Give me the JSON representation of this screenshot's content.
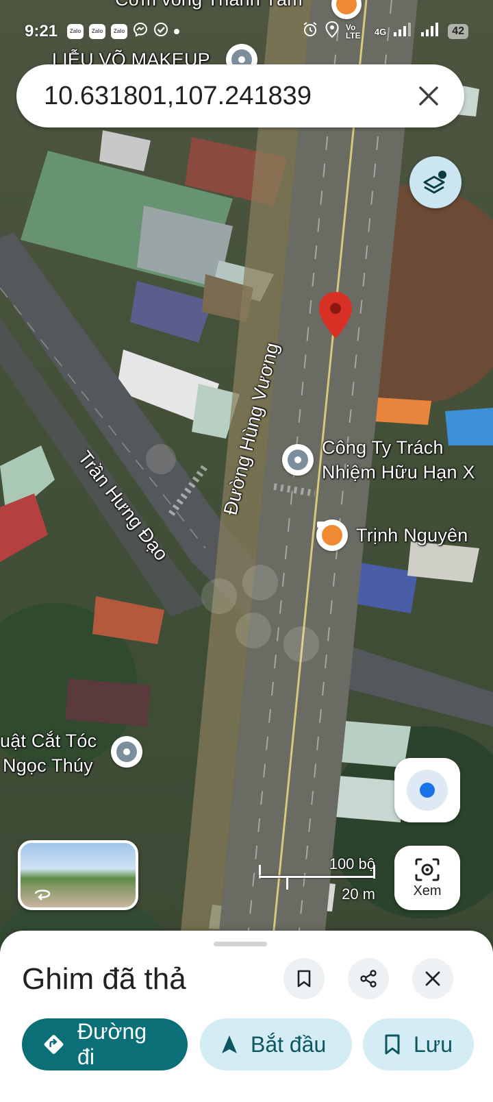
{
  "status_bar": {
    "time": "9:21",
    "zalo_labels": [
      "Zalo",
      "Zalo",
      "Zalo"
    ],
    "network_label": "Vo LTE",
    "signal_label": "4G",
    "battery": "42"
  },
  "search": {
    "value": "10.631801,107.241839"
  },
  "map": {
    "labels": {
      "top_restaurant": "Cơm vong Thanh Tâm",
      "makeup": "LIỄU VÕ MAKEUP",
      "company_line1": "Công Ty Trách",
      "company_line2": "Nhiệm Hữu Hạn X",
      "cafe": "Trịnh Nguyên",
      "barber_line1": "uật Cắt Tóc",
      "barber_line2": "Ngọc Thúy"
    },
    "roads": {
      "hung_vuong": "Đường Hùng Vương",
      "tran_hung_dao": "Trần Hưng Đạo"
    },
    "scale": {
      "feet": "100 bộ",
      "meters": "20 m"
    },
    "lens_label": "Xem"
  },
  "sheet": {
    "title": "Ghim đã thả",
    "directions_label": "Đường đi",
    "start_label": "Bắt đầu",
    "save_label": "Lưu"
  },
  "colors": {
    "primary": "#0b6f78",
    "secondary": "#d4ecf3",
    "pin": "#d93025",
    "location_blue": "#1a73e8"
  }
}
